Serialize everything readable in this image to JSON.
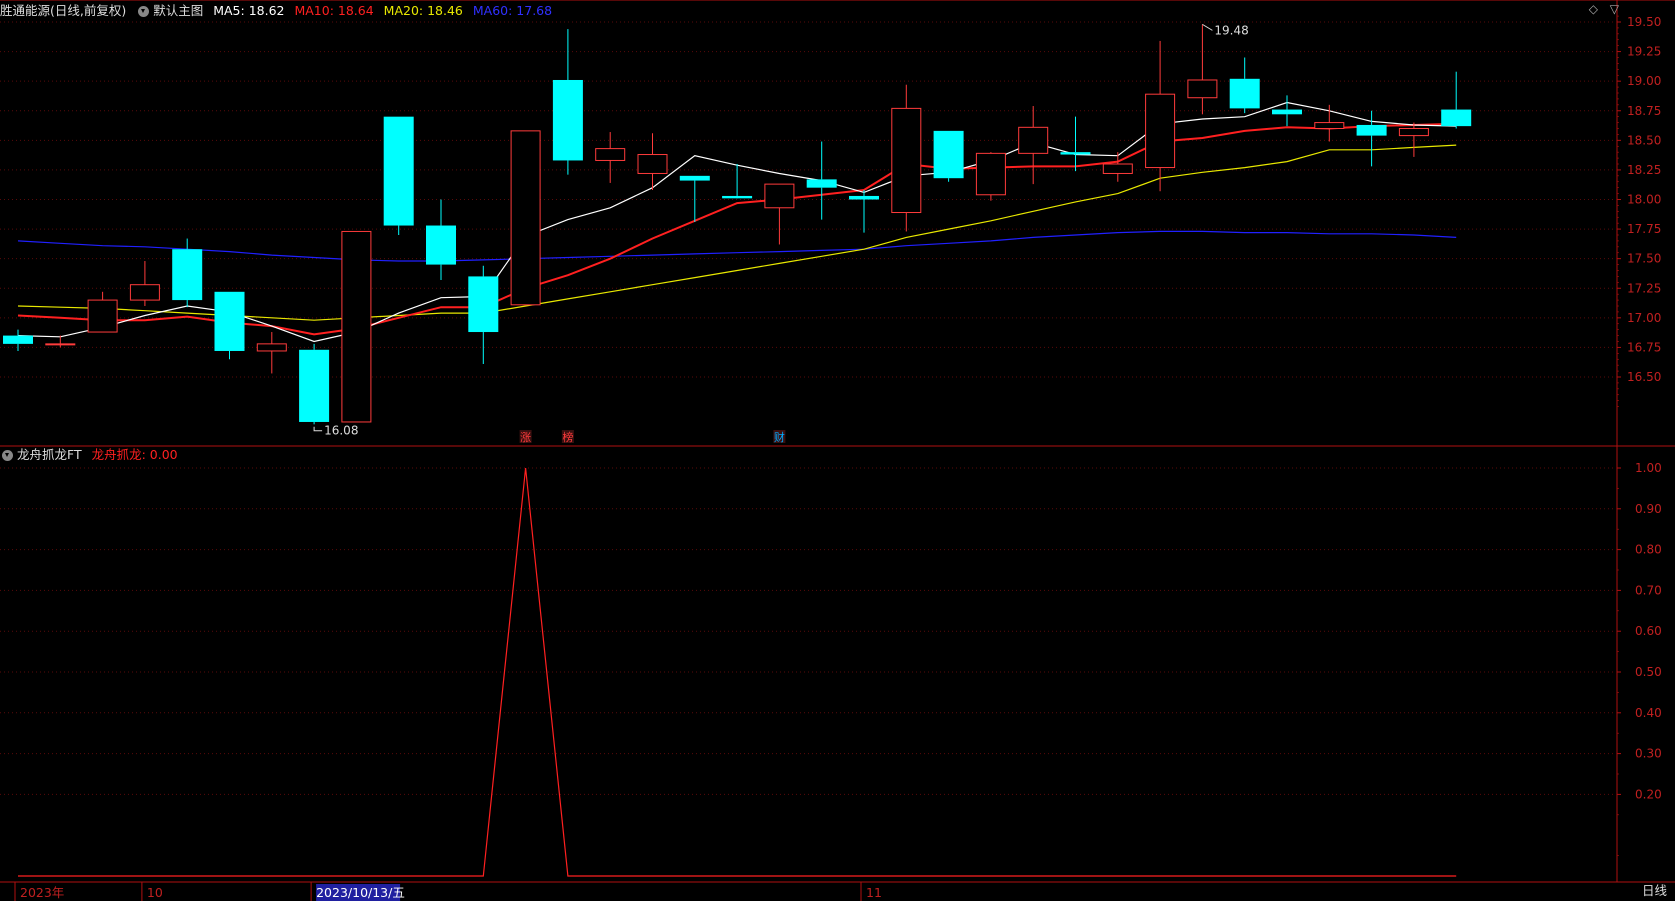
{
  "header": {
    "stock_title": "胜通能源(日线,前复权)",
    "main_chart_name": "默认主图",
    "ma5_label": "MA5: 18.62",
    "ma10_label": "MA10: 18.64",
    "ma20_label": "MA20: 18.46",
    "ma60_label": "MA60: 17.68"
  },
  "indicator_header": {
    "name": "龙舟抓龙FT",
    "value_label": "龙舟抓龙: 0.00"
  },
  "colors": {
    "up": "#ff3b3b",
    "down": "#00ffff",
    "ma5": "#ffffff",
    "ma10": "#ff2020",
    "ma20": "#e8e800",
    "ma60": "#2020ff",
    "axis": "#b01010",
    "signal": "#ff2020"
  },
  "chart_data": [
    {
      "type": "candlestick",
      "price_axis_ticks": [
        "19.50",
        "19.25",
        "19.00",
        "18.75",
        "18.50",
        "18.25",
        "18.00",
        "17.75",
        "17.50",
        "17.25",
        "17.00",
        "16.75",
        "16.50"
      ],
      "ylim": [
        16.08,
        19.64
      ],
      "candles": [
        {
          "o": 16.85,
          "h": 16.9,
          "l": 16.72,
          "c": 16.78
        },
        {
          "o": 16.78,
          "h": 16.85,
          "l": 16.75,
          "c": 16.78
        },
        {
          "o": 16.88,
          "h": 17.22,
          "l": 16.88,
          "c": 17.15
        },
        {
          "o": 17.15,
          "h": 17.48,
          "l": 17.1,
          "c": 17.28
        },
        {
          "o": 17.58,
          "h": 17.67,
          "l": 17.09,
          "c": 17.15
        },
        {
          "o": 17.22,
          "h": 17.22,
          "l": 16.65,
          "c": 16.72
        },
        {
          "o": 16.72,
          "h": 16.88,
          "l": 16.53,
          "c": 16.78
        },
        {
          "o": 16.73,
          "h": 16.78,
          "l": 16.1,
          "c": 16.12
        },
        {
          "o": 16.12,
          "h": 17.73,
          "l": 16.12,
          "c": 17.73
        },
        {
          "o": 18.7,
          "h": 18.7,
          "l": 17.7,
          "c": 17.78
        },
        {
          "o": 17.78,
          "h": 18.0,
          "l": 17.32,
          "c": 17.45
        },
        {
          "o": 17.35,
          "h": 17.44,
          "l": 16.61,
          "c": 16.88
        },
        {
          "o": 17.11,
          "h": 18.58,
          "l": 17.11,
          "c": 18.58
        },
        {
          "o": 19.01,
          "h": 19.44,
          "l": 18.21,
          "c": 18.33
        },
        {
          "o": 18.33,
          "h": 18.57,
          "l": 18.14,
          "c": 18.43
        },
        {
          "o": 18.22,
          "h": 18.56,
          "l": 18.08,
          "c": 18.38
        },
        {
          "o": 18.2,
          "h": 18.2,
          "l": 17.81,
          "c": 18.16
        },
        {
          "o": 18.03,
          "h": 18.3,
          "l": 18.03,
          "c": 18.01
        },
        {
          "o": 17.93,
          "h": 18.12,
          "l": 17.62,
          "c": 18.13
        },
        {
          "o": 18.17,
          "h": 18.49,
          "l": 17.83,
          "c": 18.1
        },
        {
          "o": 18.03,
          "h": 18.08,
          "l": 17.72,
          "c": 18.0
        },
        {
          "o": 17.89,
          "h": 18.97,
          "l": 17.73,
          "c": 18.77
        },
        {
          "o": 18.58,
          "h": 18.58,
          "l": 18.15,
          "c": 18.18
        },
        {
          "o": 18.04,
          "h": 18.4,
          "l": 17.99,
          "c": 18.39
        },
        {
          "o": 18.39,
          "h": 18.79,
          "l": 18.13,
          "c": 18.61
        },
        {
          "o": 18.4,
          "h": 18.7,
          "l": 18.24,
          "c": 18.38
        },
        {
          "o": 18.22,
          "h": 18.4,
          "l": 18.15,
          "c": 18.3
        },
        {
          "o": 18.27,
          "h": 19.34,
          "l": 18.07,
          "c": 18.89
        },
        {
          "o": 18.86,
          "h": 19.48,
          "l": 18.72,
          "c": 19.01
        },
        {
          "o": 19.02,
          "h": 19.2,
          "l": 18.73,
          "c": 18.77
        },
        {
          "o": 18.76,
          "h": 18.88,
          "l": 18.62,
          "c": 18.72
        },
        {
          "o": 18.6,
          "h": 18.8,
          "l": 18.49,
          "c": 18.65
        },
        {
          "o": 18.63,
          "h": 18.75,
          "l": 18.28,
          "c": 18.54
        },
        {
          "o": 18.54,
          "h": 18.65,
          "l": 18.36,
          "c": 18.6
        },
        {
          "o": 18.76,
          "h": 19.08,
          "l": 18.6,
          "c": 18.62
        }
      ],
      "ma5": [
        16.85,
        16.84,
        16.92,
        17.02,
        17.1,
        17.05,
        16.93,
        16.8,
        16.88,
        17.04,
        17.17,
        17.18,
        17.69,
        17.83,
        17.93,
        18.1,
        18.37,
        18.29,
        18.22,
        18.16,
        18.06,
        18.2,
        18.23,
        18.33,
        18.48,
        18.38,
        18.37,
        18.64,
        18.68,
        18.7,
        18.82,
        18.75,
        18.66,
        18.63,
        18.62
      ],
      "ma10": [
        17.02,
        17.0,
        16.98,
        16.98,
        17.01,
        16.96,
        16.93,
        16.86,
        16.91,
        17.0,
        17.09,
        17.09,
        17.25,
        17.36,
        17.5,
        17.67,
        17.82,
        17.97,
        18.0,
        18.04,
        18.08,
        18.3,
        18.26,
        18.27,
        18.28,
        18.28,
        18.32,
        18.49,
        18.52,
        18.58,
        18.61,
        18.6,
        18.62,
        18.63,
        18.64
      ],
      "ma20": [
        17.1,
        17.09,
        17.08,
        17.06,
        17.04,
        17.02,
        17.0,
        16.98,
        17.0,
        17.02,
        17.04,
        17.04,
        17.1,
        17.16,
        17.22,
        17.28,
        17.34,
        17.4,
        17.46,
        17.52,
        17.58,
        17.68,
        17.75,
        17.82,
        17.9,
        17.98,
        18.05,
        18.18,
        18.23,
        18.27,
        18.32,
        18.42,
        18.42,
        18.44,
        18.46
      ],
      "ma60": [
        17.65,
        17.63,
        17.61,
        17.6,
        17.58,
        17.56,
        17.53,
        17.51,
        17.49,
        17.48,
        17.48,
        17.49,
        17.5,
        17.51,
        17.52,
        17.53,
        17.54,
        17.55,
        17.56,
        17.57,
        17.58,
        17.61,
        17.63,
        17.65,
        17.68,
        17.7,
        17.72,
        17.73,
        17.73,
        17.72,
        17.72,
        17.71,
        17.71,
        17.7,
        17.68
      ],
      "annotations": [
        {
          "text": "19.48",
          "candle": 28,
          "price": 19.48,
          "kind": "high"
        },
        {
          "text": "16.08",
          "candle": 7,
          "price": 16.08,
          "kind": "low"
        }
      ],
      "event_markers": [
        {
          "candle": 12,
          "label": "涨",
          "color": "#ff3b3b"
        },
        {
          "candle": 13,
          "label": "榜",
          "color": "#ff3b3b"
        },
        {
          "candle": 18,
          "label": "财",
          "color": "#00aaff"
        }
      ]
    },
    {
      "type": "line",
      "series": [
        {
          "name": "龙舟抓龙",
          "values": [
            0,
            0,
            0,
            0,
            0,
            0,
            0,
            0,
            0,
            0,
            0,
            0,
            1,
            0,
            0,
            0,
            0,
            0,
            0,
            0,
            0,
            0,
            0,
            0,
            0,
            0,
            0,
            0,
            0,
            0,
            0,
            0,
            0,
            0,
            0
          ]
        }
      ],
      "axis_ticks": [
        "1.00",
        "0.90",
        "0.80",
        "0.70",
        "0.60",
        "0.50",
        "0.40",
        "0.30",
        "0.20"
      ],
      "ylim": [
        0,
        1
      ]
    }
  ],
  "date_axis": {
    "labels": [
      {
        "text": "2023年",
        "candle": 0
      },
      {
        "text": "10",
        "candle": 3
      },
      {
        "text": "2023/10/13/五",
        "candle": 7,
        "highlight": true
      },
      {
        "text": "11",
        "candle": 20
      }
    ]
  },
  "toolbar": {
    "period": "日线",
    "icon_a": "◇",
    "icon_b": "▽"
  }
}
